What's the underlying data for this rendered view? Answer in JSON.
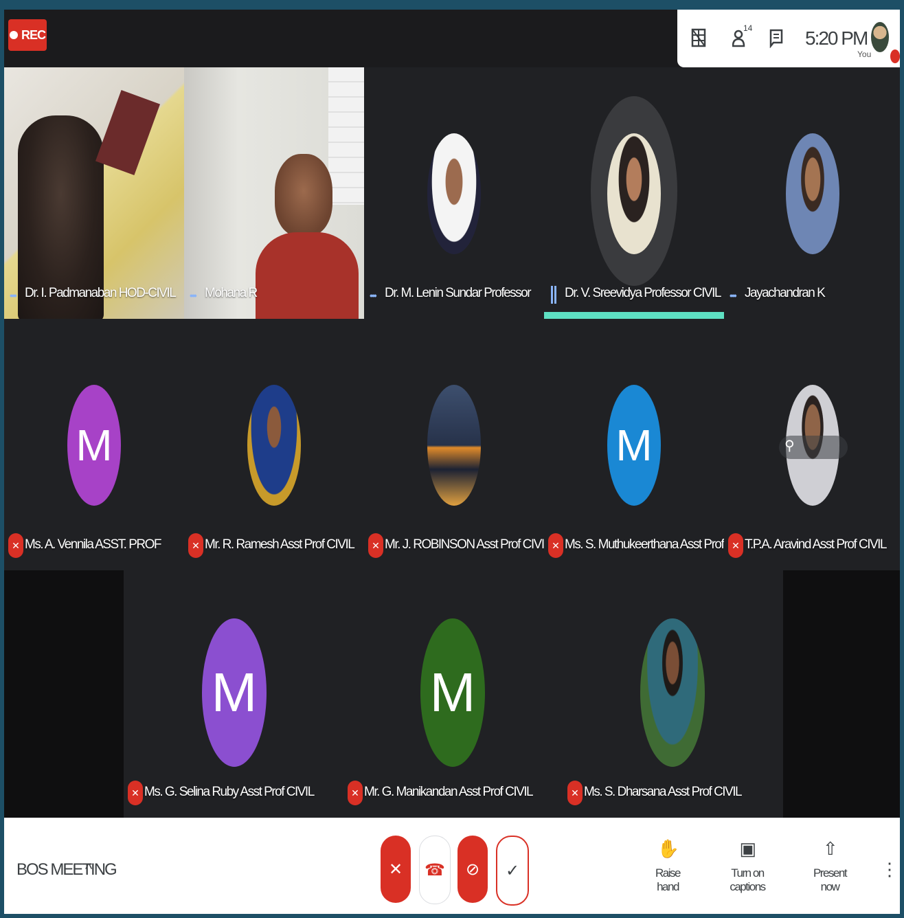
{
  "topbar": {
    "rec_label": "REC",
    "participants_count": "14",
    "time": "5:20 PM",
    "you_label": "You"
  },
  "participants": [
    {
      "name": "Dr. I. Padmanaban HOD-CIVIL",
      "muted": false
    },
    {
      "name": "Mohana R",
      "muted": false
    },
    {
      "name": "Dr. M. Lenin Sundar Professor",
      "muted": false
    },
    {
      "name": "Dr. V. Sreevidya Professor CIVIL",
      "muted": false,
      "speaking": true
    },
    {
      "name": "Jayachandran K",
      "muted": false
    },
    {
      "name": "Ms. A. Vennila ASST. PROF",
      "muted": true,
      "initial": "M",
      "color": "#a742c7"
    },
    {
      "name": "Mr. R. Ramesh Asst Prof CIVIL",
      "muted": true
    },
    {
      "name": "Mr. J. ROBINSON Asst Prof CIVIL",
      "muted": true
    },
    {
      "name": "Ms. S. Muthukeerthana Asst Prof CIVIL",
      "muted": true,
      "initial": "M",
      "color": "#1a88d4"
    },
    {
      "name": "T.P.A. Aravind Asst Prof CIVIL",
      "muted": true
    },
    {
      "name": "Ms. G. Selina Ruby Asst Prof CIVIL",
      "muted": true,
      "initial": "M",
      "color": "#8b4fd0"
    },
    {
      "name": "Mr. G. Manikandan Asst Prof CIVIL",
      "muted": true,
      "initial": "M",
      "color": "#2e6b1e"
    },
    {
      "name": "Ms. S. Dharsana Asst Prof CIVIL",
      "muted": true
    }
  ],
  "bottombar": {
    "meeting_title": "BOS MEETING",
    "raise_hand": "Raise hand",
    "captions": "Turn on captions",
    "present": "Present now"
  },
  "colors": {
    "red": "#d93025",
    "speaking_bar": "#5ee0c2",
    "tile_bg": "#202124"
  }
}
